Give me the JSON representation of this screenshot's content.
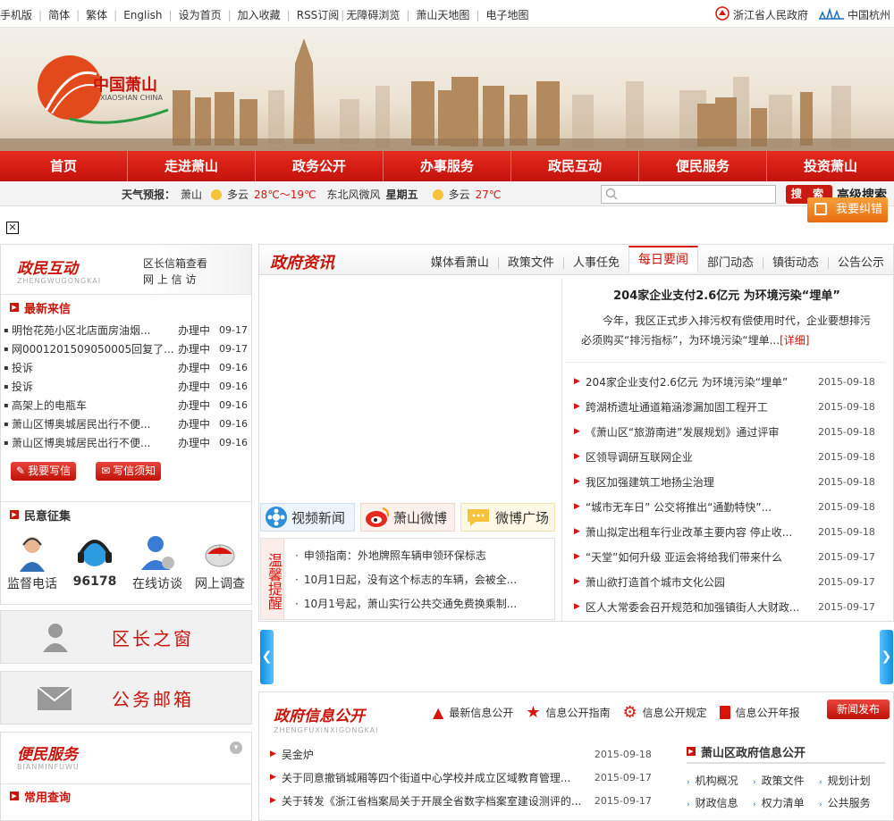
{
  "topbar": {
    "links": [
      "手机版",
      "简体",
      "繁体",
      "English",
      "设为首页",
      "加入收藏",
      "RSS订阅",
      "无障碍浏览",
      "萧山天地图",
      "电子地图"
    ],
    "right": [
      "浙江省人民政府",
      "中国杭州"
    ]
  },
  "logo": {
    "text": "中国萧山",
    "sub": "XIAOSHAN CHINA"
  },
  "nav": [
    "首页",
    "走进萧山",
    "政务公开",
    "办事服务",
    "政民互动",
    "便民服务",
    "投资萧山"
  ],
  "weather": {
    "label": "天气预报：",
    "city": "萧山",
    "cond1": "多云",
    "temp1": "28℃～19℃",
    "wind": "东北风微风",
    "day": "星期五",
    "cond2": "多云",
    "temp2": "27℃"
  },
  "search": {
    "button": "搜 索",
    "advanced": "高级搜索"
  },
  "report_button": "我要纠错",
  "interaction": {
    "title": "政民互动",
    "sub": "ZHENGWUGONGKAI",
    "link1": "区长信箱查看",
    "link2": "网 上 信 访",
    "latest_title": "最新来信",
    "letters": [
      {
        "title": "明怡花苑小区北店面房油烟...",
        "status": "办理中",
        "date": "09-17"
      },
      {
        "title": "网0001201509050005回复了...",
        "status": "办理中",
        "date": "09-17"
      },
      {
        "title": "投诉",
        "status": "办理中",
        "date": "09-16"
      },
      {
        "title": "投诉",
        "status": "办理中",
        "date": "09-16"
      },
      {
        "title": "高架上的电瓶车",
        "status": "办理中",
        "date": "09-16"
      },
      {
        "title": "萧山区博奥城居民出行不便...",
        "status": "办理中",
        "date": "09-16"
      },
      {
        "title": "萧山区博奥城居民出行不便...",
        "status": "办理中",
        "date": "09-16"
      }
    ],
    "btn_write": "我要写信",
    "btn_notice": "写信须知",
    "opinion_title": "民意征集",
    "opinion_items": [
      "监督电话",
      "96178",
      "在线访谈",
      "网上调查"
    ]
  },
  "mayor_window": "区长之窗",
  "mailbox": "公务邮箱",
  "service": {
    "title": "便民服务",
    "sub": "BIANMINFUWU",
    "query_title": "常用查询"
  },
  "news": {
    "title": "政府资讯",
    "tabs": [
      "媒体看萧山",
      "政策文件",
      "人事任免",
      "每日要闻",
      "部门动态",
      "镇街动态",
      "公告公示"
    ],
    "active_tab": "每日要闻",
    "headline": "204家企业支付2.6亿元 为环境污染“埋单”",
    "summary": "今年，我区正式步入排污权有偿使用时代，企业要想排污必须购买“排污指标”，为环境污染“埋单...",
    "detail": "[详细]",
    "items": [
      {
        "title": "204家企业支付2.6亿元 为环境污染“埋单”",
        "date": "2015-09-18"
      },
      {
        "title": "跨湖桥遗址通道箱涵渗漏加固工程开工",
        "date": "2015-09-18"
      },
      {
        "title": "《萧山区“旅游南进”发展规划》通过评审",
        "date": "2015-09-18"
      },
      {
        "title": "区领导调研互联网企业",
        "date": "2015-09-18"
      },
      {
        "title": "我区加强建筑工地扬尘治理",
        "date": "2015-09-18"
      },
      {
        "title": "“城市无车日” 公交将推出“通勤特快”...",
        "date": "2015-09-18"
      },
      {
        "title": "萧山拟定出租车行业改革主要内容 停止收...",
        "date": "2015-09-18"
      },
      {
        "title": "“天堂”如何升级 亚运会将给我们带来什么",
        "date": "2015-09-17"
      },
      {
        "title": "萧山欲打造首个城市文化公园",
        "date": "2015-09-17"
      },
      {
        "title": "区人大常委会召开规范和加强镇街人大财政...",
        "date": "2015-09-17"
      }
    ]
  },
  "media": {
    "video": "视频新闻",
    "weibo": "萧山微博",
    "plaza": "微博广场"
  },
  "warm": {
    "label": "温馨提醒",
    "items": [
      "申领指南：外地牌照车辆申领环保标志",
      "10月1日起，没有这个标志的车辆，会被全...",
      "10月1号起，萧山实行公共交通免费换乘制..."
    ]
  },
  "info": {
    "title": "政府信息公开",
    "sub": "ZHENGFUXINXIGONGKAI",
    "links": [
      "最新信息公开",
      "信息公开指南",
      "信息公开规定",
      "信息公开年报"
    ],
    "release": "新闻发布",
    "items": [
      {
        "title": "吴金炉",
        "date": "2015-09-18"
      },
      {
        "title": "关于同意撤销城厢等四个街道中心学校并成立区域教育管理...",
        "date": "2015-09-17"
      },
      {
        "title": "关于转发《浙江省档案局关于开展全省数字档案室建设测评的...",
        "date": "2015-09-17"
      }
    ],
    "side_title": "萧山区政府信息公开",
    "side_links": [
      "机构概况",
      "政策文件",
      "规划计划",
      "财政信息",
      "权力清单",
      "公共服务"
    ]
  },
  "colors": {
    "brand": "#d7150d",
    "nav": "#cc160d"
  }
}
